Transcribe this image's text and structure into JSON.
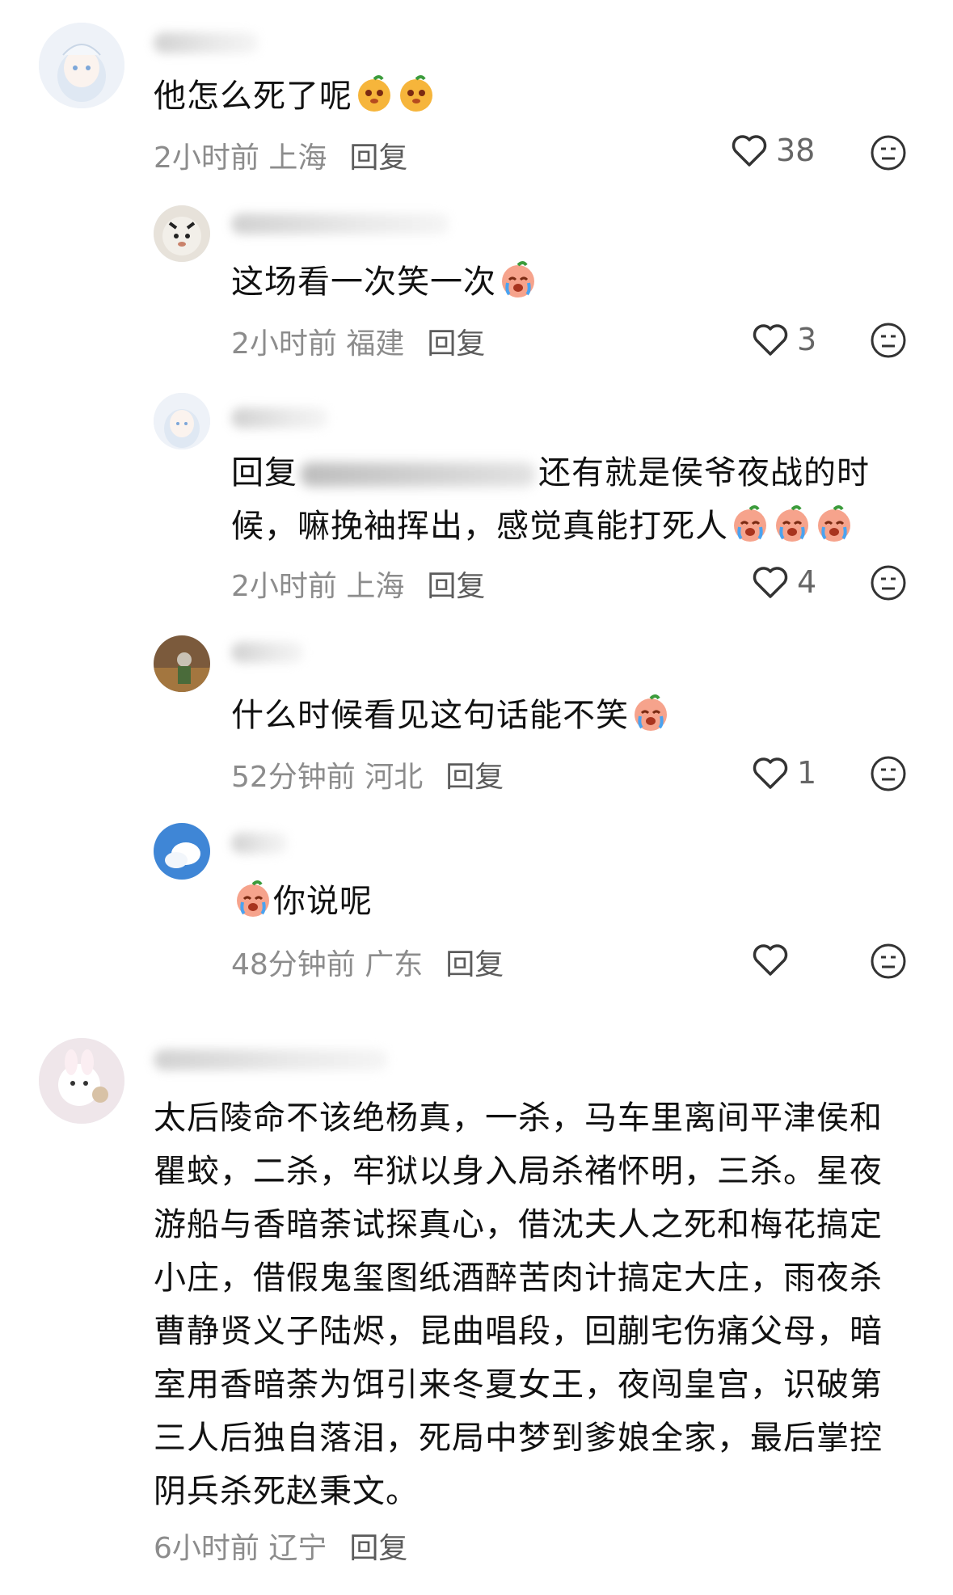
{
  "comments": [
    {
      "text": "他怎么死了呢",
      "time": "2小时前",
      "location": "上海",
      "reply": "回复",
      "likes": "38"
    },
    {
      "text": "这场看一次笑一次",
      "time": "2小时前",
      "location": "福建",
      "reply": "回复",
      "likes": "3"
    },
    {
      "prefix": "回复",
      "text_line1": "还有就是侯爷夜战的时",
      "text_line2": "候，嘛挽袖挥出，感觉真能打死人",
      "time": "2小时前",
      "location": "上海",
      "reply": "回复",
      "likes": "4"
    },
    {
      "text": "什么时候看见这句话能不笑",
      "time": "52分钟前",
      "location": "河北",
      "reply": "回复",
      "likes": "1"
    },
    {
      "text": "你说呢",
      "time": "48分钟前",
      "location": "广东",
      "reply": "回复",
      "likes": ""
    },
    {
      "lines": [
        "太后陵命不该绝杨真，一杀，马车里离间平津侯和",
        "瞿蛟，二杀，牢狱以身入局杀褚怀明，三杀。星夜",
        "游船与香暗荼试探真心，借沈夫人之死和梅花搞定",
        "小庄，借假鬼玺图纸酒醉苦肉计搞定大庄，雨夜杀",
        "曹静贤义子陆烬，昆曲唱段，回蒯宅伤痛父母，暗",
        "室用香暗荼为饵引来冬夏女王，夜闯皇宫，识破第",
        "三人后独自落泪，死局中梦到爹娘全家，最后掌控",
        "阴兵杀死赵秉文。"
      ],
      "time": "6小时前",
      "location": "辽宁",
      "reply": "回复"
    }
  ],
  "colors": {
    "text": "#111111",
    "meta": "#8c8c8c",
    "icon": "#333333"
  }
}
